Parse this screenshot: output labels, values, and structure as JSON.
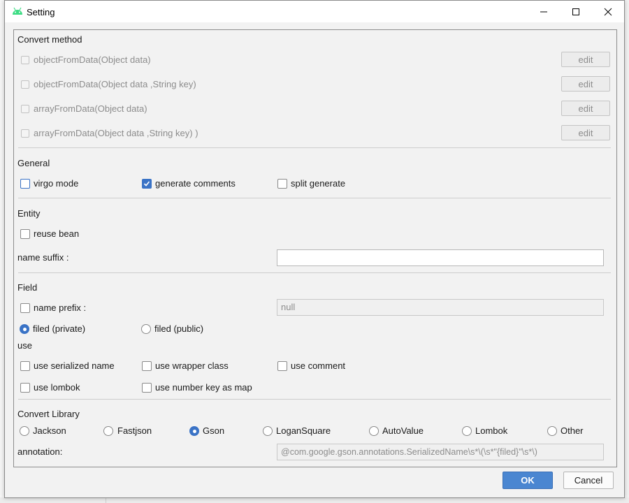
{
  "window": {
    "title": "Setting",
    "minimize_icon": "minimize-icon",
    "maximize_icon": "maximize-icon",
    "close_icon": "close-icon",
    "app_icon": "android-icon"
  },
  "convert_method": {
    "heading": "Convert method",
    "items": [
      {
        "label": "objectFromData(Object data)",
        "checked": false,
        "enabled": false,
        "button": "edit"
      },
      {
        "label": "objectFromData(Object data ,String key)",
        "checked": false,
        "enabled": false,
        "button": "edit"
      },
      {
        "label": "arrayFromData(Object data)",
        "checked": false,
        "enabled": false,
        "button": "edit"
      },
      {
        "label": "arrayFromData(Object data ,String key) )",
        "checked": false,
        "enabled": false,
        "button": "edit"
      }
    ]
  },
  "general": {
    "heading": "General",
    "virgo_mode": {
      "label": "virgo mode",
      "checked": false
    },
    "generate_comments": {
      "label": "generate comments",
      "checked": true
    },
    "split_generate": {
      "label": "split generate",
      "checked": false
    }
  },
  "entity": {
    "heading": "Entity",
    "reuse_bean": {
      "label": "reuse bean",
      "checked": false
    },
    "name_suffix": {
      "label": "name suffix :",
      "value": ""
    }
  },
  "field": {
    "heading": "Field",
    "name_prefix": {
      "label": "name prefix :",
      "checked": false,
      "value": "null"
    },
    "filed_private": {
      "label": "filed (private)",
      "selected": true
    },
    "filed_public": {
      "label": "filed (public)",
      "selected": false
    },
    "use_heading": "use",
    "use_serialized_name": {
      "label": "use serialized name",
      "checked": false
    },
    "use_wrapper_class": {
      "label": "use wrapper class",
      "checked": false
    },
    "use_comment": {
      "label": "use comment",
      "checked": false
    },
    "use_lombok": {
      "label": "use lombok",
      "checked": false
    },
    "use_number_key_as_map": {
      "label": "use number key as map",
      "checked": false
    }
  },
  "convert_library": {
    "heading": "Convert Library",
    "options": [
      "Jackson",
      "Fastjson",
      "Gson",
      "LoganSquare",
      "AutoValue",
      "Lombok",
      "Other"
    ],
    "selected": "Gson",
    "annotation_label": "annotation:",
    "annotation_value": "@com.google.gson.annotations.SerializedName\\s*\\(\\s*\"{filed}\"\\s*\\)"
  },
  "footer": {
    "ok_label": "OK",
    "cancel_label": "Cancel"
  },
  "colors": {
    "accent": "#3a73c6",
    "ok_button": "#4a86d1"
  }
}
